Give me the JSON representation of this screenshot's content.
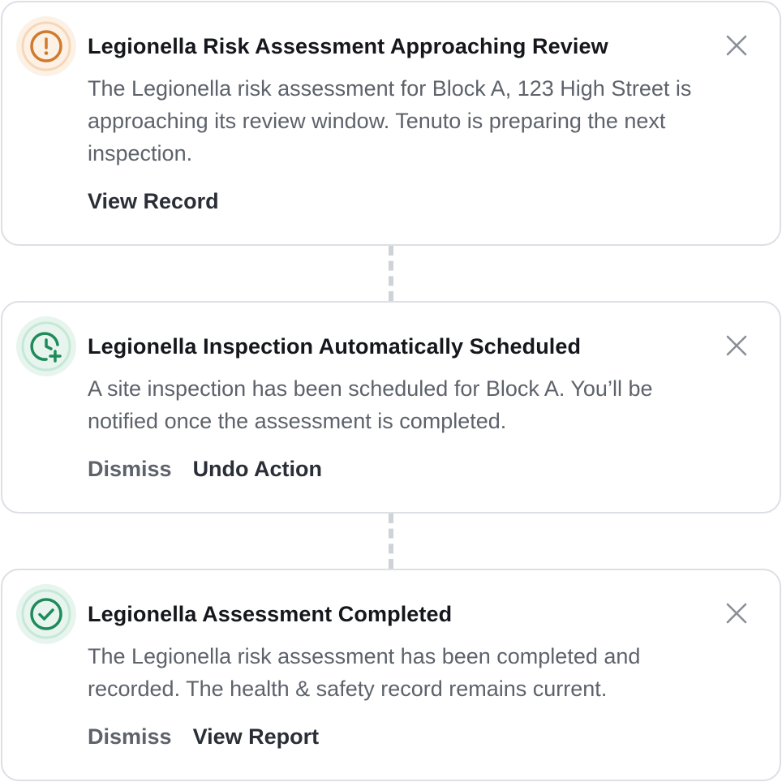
{
  "notifications": [
    {
      "title": "Legionella Risk Assessment Approaching Review",
      "body": "The Legionella risk assessment for Block A, 123 High Street is approaching its review window. Tenuto is preparing the next inspection.",
      "icon": "warning-circle-icon",
      "accent": "#cf7a2c",
      "actions": [
        "View Record"
      ]
    },
    {
      "title": "Legionella Inspection Automatically Scheduled",
      "body": "A site inspection has been scheduled for Block A. You’ll be notified once the assessment is completed.",
      "icon": "clock-plus-icon",
      "accent": "#1f8a5a",
      "actions": [
        "Dismiss",
        "Undo Action"
      ]
    },
    {
      "title": "Legionella Assessment Completed",
      "body": "The Legionella risk assessment has been completed and recorded. The health & safety record remains current.",
      "icon": "check-circle-icon",
      "accent": "#1f8a5a",
      "actions": [
        "Dismiss",
        "View Report"
      ]
    }
  ],
  "colors": {
    "warning": "#cf7a2c",
    "success": "#1f8a5a",
    "border": "#dcdfe4",
    "connector": "#cfd2d7"
  }
}
